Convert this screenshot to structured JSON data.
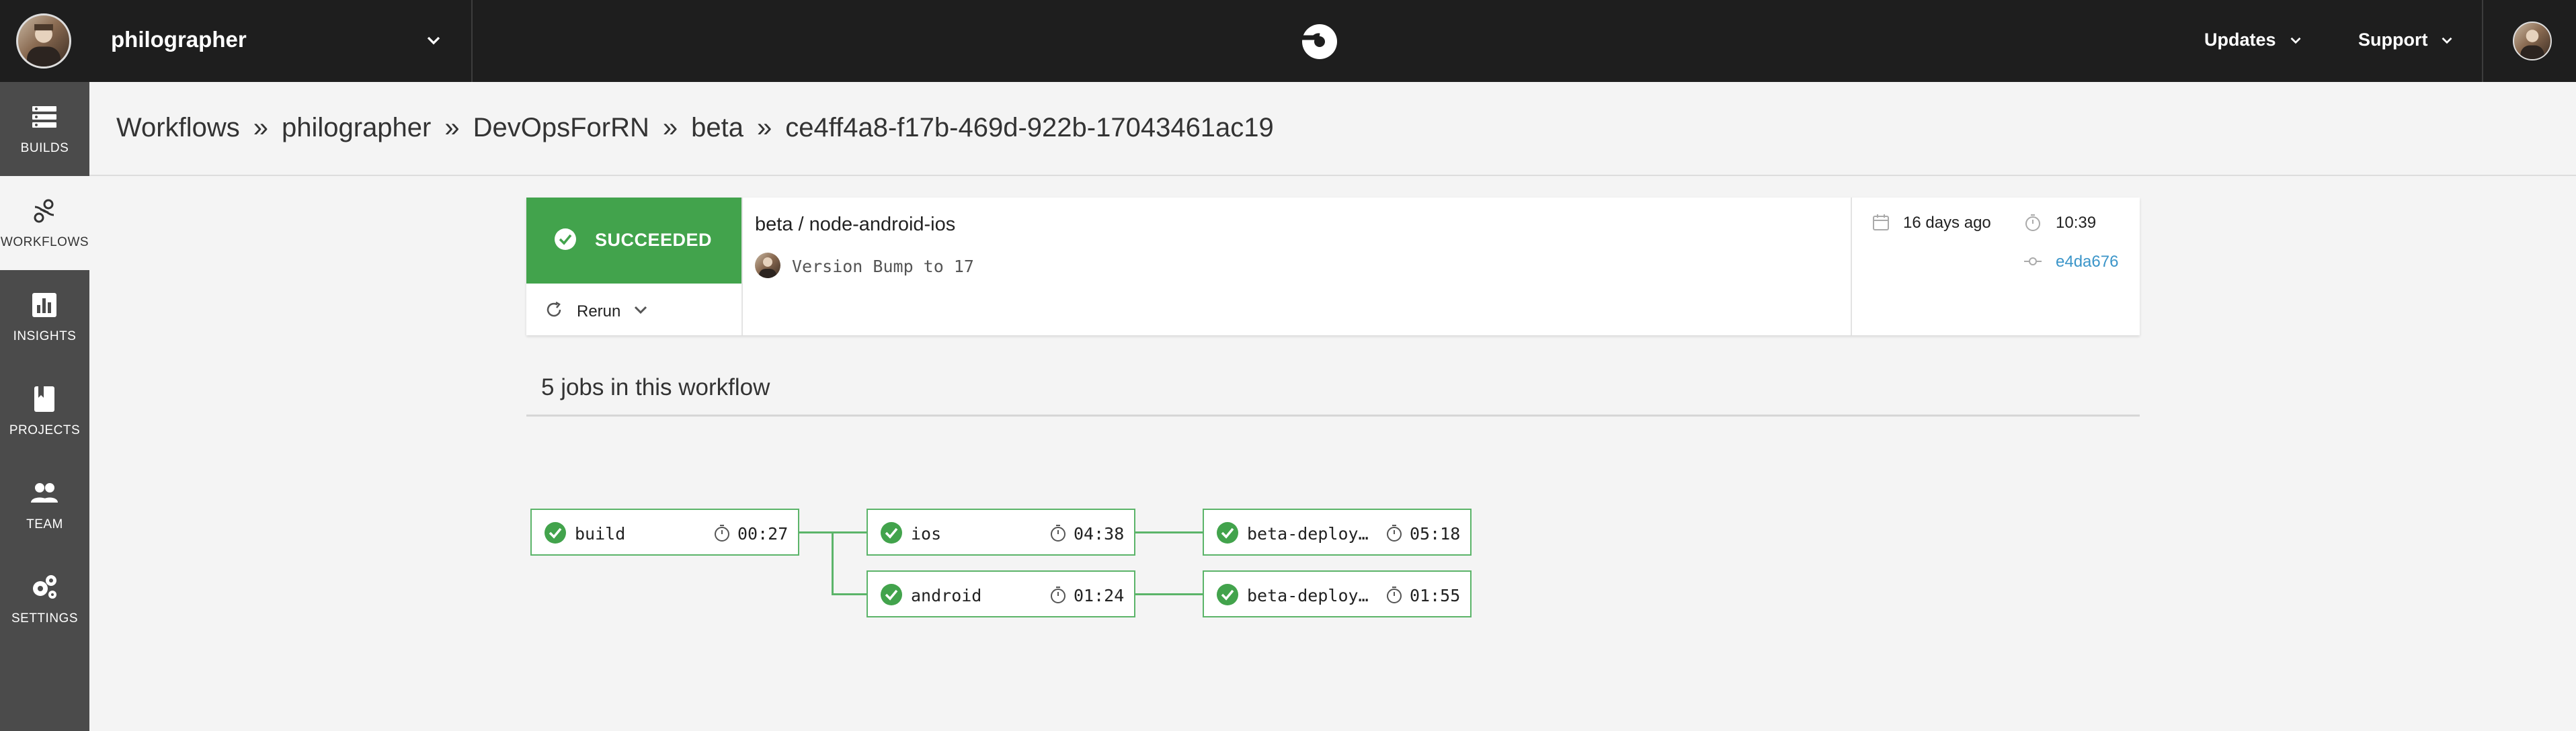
{
  "topbar": {
    "org_name": "philographer",
    "updates_label": "Updates",
    "support_label": "Support"
  },
  "sidebar": {
    "items": [
      {
        "label": "BUILDS",
        "icon": "builds-icon"
      },
      {
        "label": "WORKFLOWS",
        "icon": "workflows-icon",
        "active": true
      },
      {
        "label": "INSIGHTS",
        "icon": "insights-icon"
      },
      {
        "label": "PROJECTS",
        "icon": "projects-icon"
      },
      {
        "label": "TEAM",
        "icon": "team-icon"
      },
      {
        "label": "SETTINGS",
        "icon": "settings-icon"
      }
    ]
  },
  "breadcrumb": {
    "items": [
      "Workflows",
      "philographer",
      "DevOpsForRN",
      "beta",
      "ce4ff4a8-f17b-469d-922b-17043461ac19"
    ],
    "separator": "»"
  },
  "workflow": {
    "status": "SUCCEEDED",
    "rerun_label": "Rerun",
    "name": "beta / node-android-ios",
    "commit_message": "Version Bump to 17",
    "date": "16 days ago",
    "duration": "10:39",
    "commit_hash": "e4da676"
  },
  "jobs": {
    "title": "5 jobs in this workflow",
    "items": [
      {
        "name": "build",
        "time": "00:27"
      },
      {
        "name": "ios",
        "time": "04:38"
      },
      {
        "name": "android",
        "time": "01:24"
      },
      {
        "name": "beta-deploy-…",
        "time": "05:18"
      },
      {
        "name": "beta-deploy-…",
        "time": "01:55"
      }
    ]
  },
  "colors": {
    "success": "#42a34c",
    "job_border": "#5bb469",
    "link": "#3b95c9",
    "topbar": "#1e1e1e",
    "sidebar": "#4b4b4b"
  }
}
